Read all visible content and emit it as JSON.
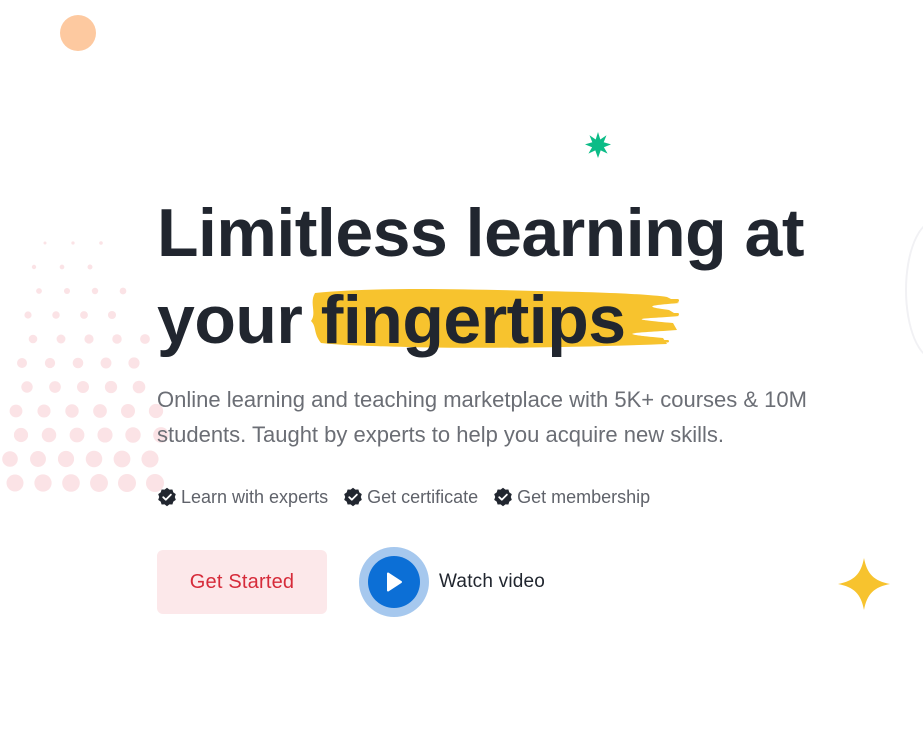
{
  "hero": {
    "title_line1": "Limitless learning at",
    "title_line2_prefix": "your",
    "title_highlight": "fingertips",
    "subtitle": "Online learning and teaching marketplace with 5K+ courses & 10M students. Taught by experts to help you acquire new skills."
  },
  "features": [
    {
      "label": "Learn with experts",
      "icon": "badge-check-icon"
    },
    {
      "label": "Get certificate",
      "icon": "badge-check-icon"
    },
    {
      "label": "Get membership",
      "icon": "badge-check-icon"
    }
  ],
  "actions": {
    "primary_label": "Get Started",
    "video_label": "Watch video",
    "video_icon": "play-icon"
  },
  "colors": {
    "title": "#21262f",
    "highlight": "#f7c32e",
    "primary_button_bg": "#fce8ea",
    "primary_button_text": "#d62b3a",
    "play_button": "#0c6fd6",
    "accent_green": "#0cbc87",
    "accent_peach": "#fdc9a0",
    "dots": "#fbe3e6"
  }
}
